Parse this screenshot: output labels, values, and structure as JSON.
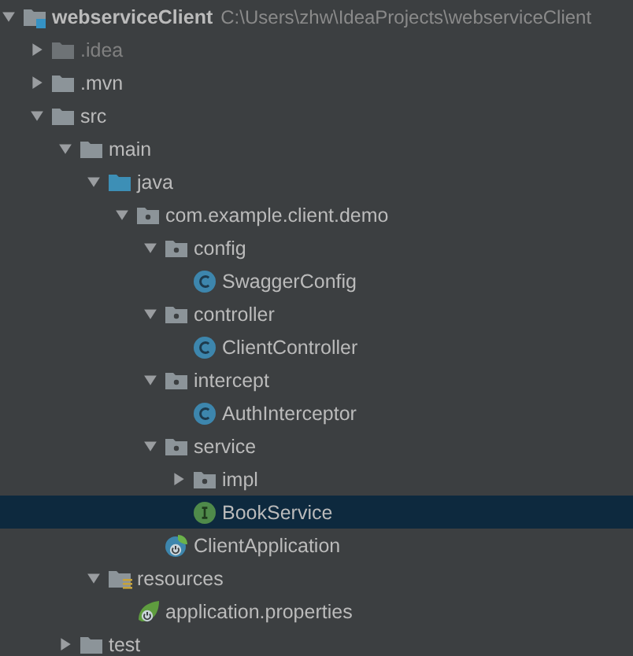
{
  "project_tree": [
    {
      "kind": "module",
      "name": "webserviceClient",
      "path": "C:\\Users\\zhw\\IdeaProjects\\webserviceClient",
      "expanded": true,
      "selected": false,
      "children": [
        {
          "kind": "excluded-folder",
          "name": ".idea",
          "expanded": false,
          "selected": false
        },
        {
          "kind": "folder",
          "name": ".mvn",
          "expanded": false,
          "selected": false
        },
        {
          "kind": "folder",
          "name": "src",
          "expanded": true,
          "selected": false,
          "children": [
            {
              "kind": "folder",
              "name": "main",
              "expanded": true,
              "selected": false,
              "children": [
                {
                  "kind": "source-folder",
                  "name": "java",
                  "expanded": true,
                  "selected": false,
                  "children": [
                    {
                      "kind": "package",
                      "name": "com.example.client.demo",
                      "expanded": true,
                      "selected": false,
                      "children": [
                        {
                          "kind": "package",
                          "name": "config",
                          "expanded": true,
                          "selected": false,
                          "children": [
                            {
                              "kind": "class",
                              "name": "SwaggerConfig",
                              "selected": false
                            }
                          ]
                        },
                        {
                          "kind": "package",
                          "name": "controller",
                          "expanded": true,
                          "selected": false,
                          "children": [
                            {
                              "kind": "class",
                              "name": "ClientController",
                              "selected": false
                            }
                          ]
                        },
                        {
                          "kind": "package",
                          "name": "intercept",
                          "expanded": true,
                          "selected": false,
                          "children": [
                            {
                              "kind": "class",
                              "name": "AuthInterceptor",
                              "selected": false
                            }
                          ]
                        },
                        {
                          "kind": "package",
                          "name": "service",
                          "expanded": true,
                          "selected": false,
                          "children": [
                            {
                              "kind": "package",
                              "name": "impl",
                              "expanded": false,
                              "selected": false
                            },
                            {
                              "kind": "interface",
                              "name": "BookService",
                              "selected": true
                            }
                          ]
                        },
                        {
                          "kind": "spring-app",
                          "name": "ClientApplication",
                          "selected": false
                        }
                      ]
                    }
                  ]
                },
                {
                  "kind": "resources-folder",
                  "name": "resources",
                  "expanded": true,
                  "selected": false,
                  "children": [
                    {
                      "kind": "spring-properties",
                      "name": "application.properties",
                      "selected": false
                    }
                  ]
                }
              ]
            },
            {
              "kind": "folder",
              "name": "test",
              "expanded": false,
              "selected": false
            }
          ]
        }
      ]
    }
  ]
}
